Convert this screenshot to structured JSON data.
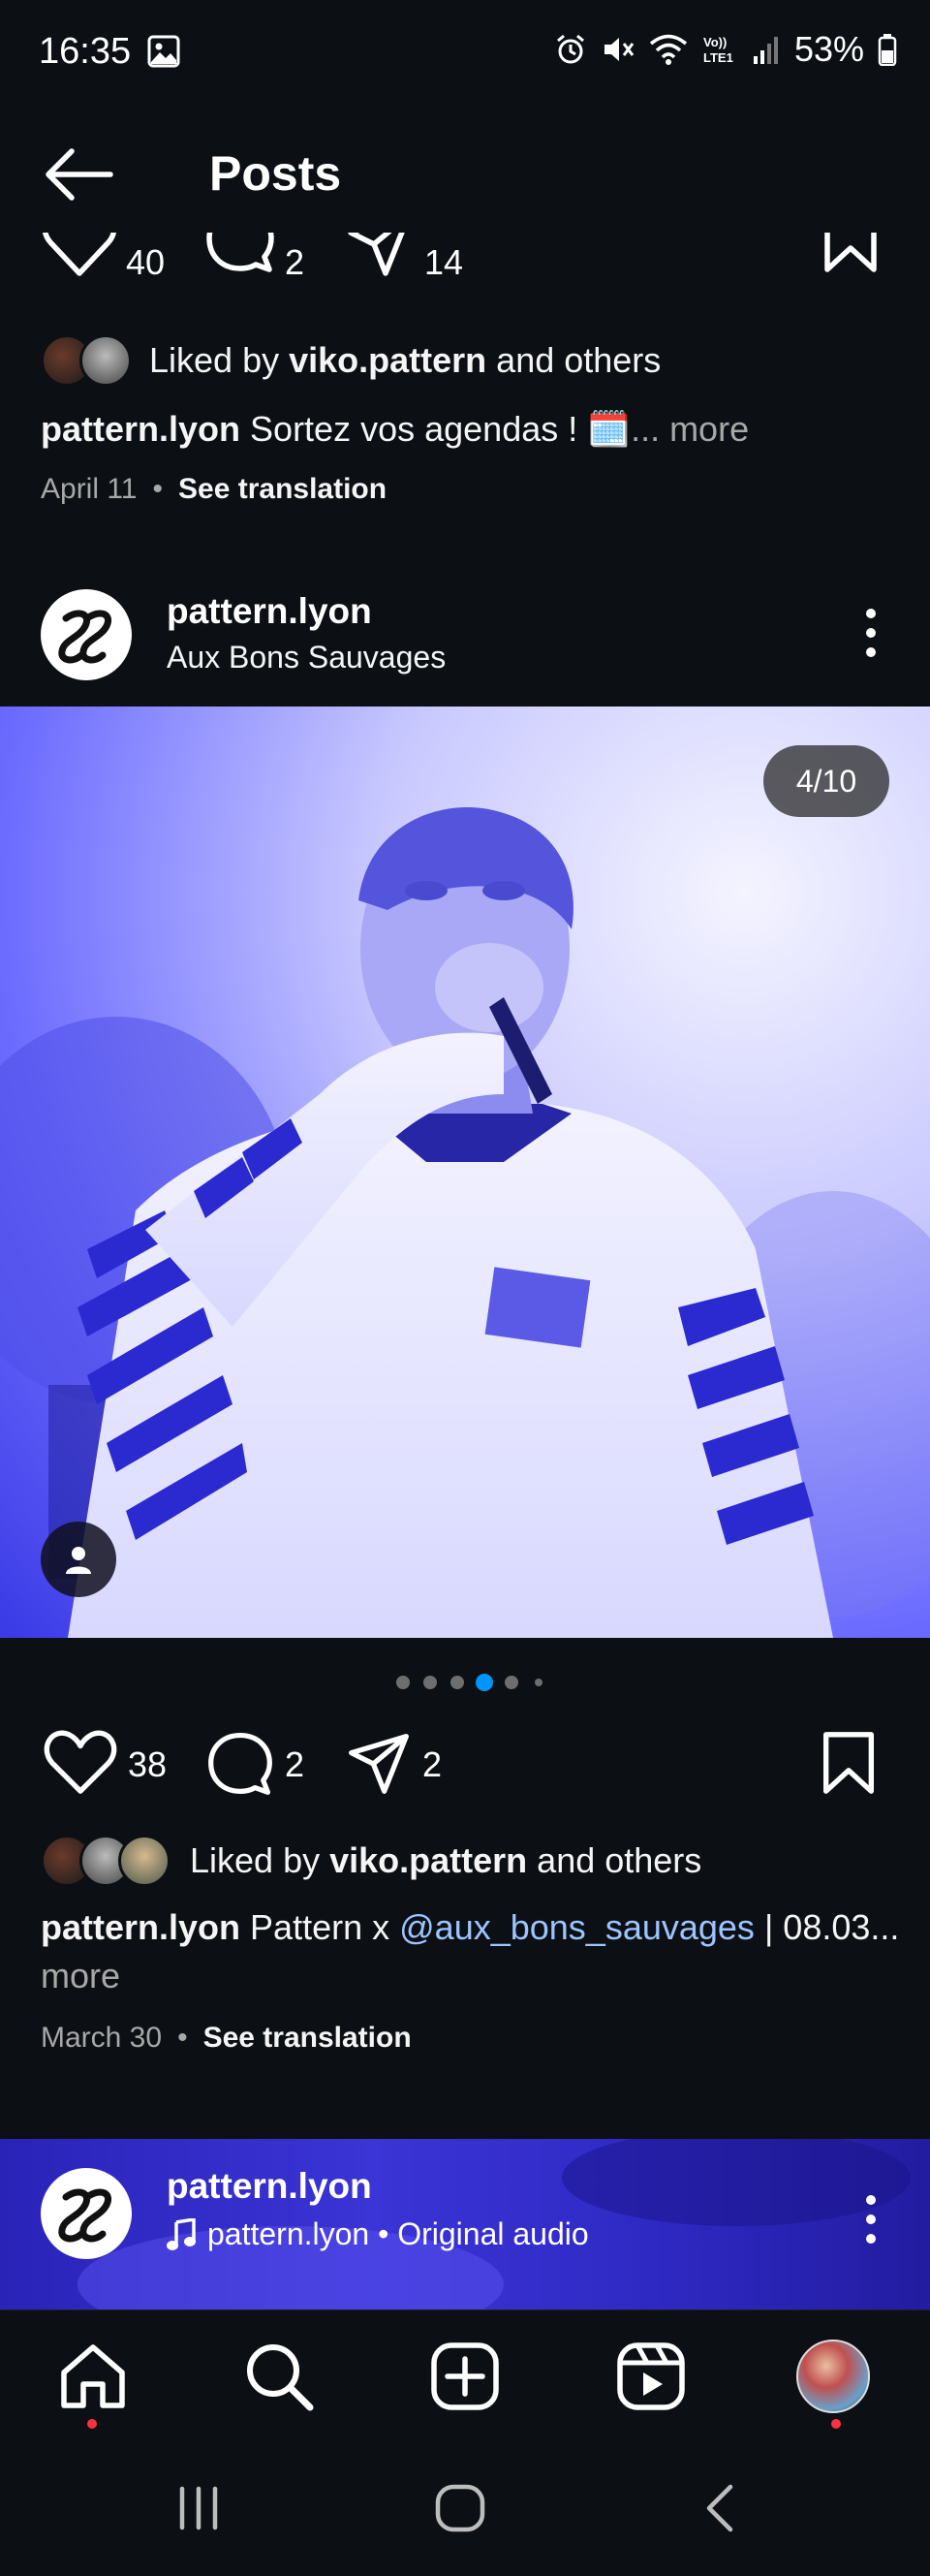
{
  "status_bar": {
    "time": "16:35",
    "battery": "53%",
    "icons": [
      "gallery-icon",
      "alarm-icon",
      "mute-icon",
      "wifi-icon",
      "volte-icon",
      "signal-icon",
      "battery-icon"
    ]
  },
  "header": {
    "title": "Posts",
    "back_icon": "arrow-left-icon"
  },
  "prev_post": {
    "likes": "40",
    "comments": "2",
    "shares": "14",
    "liked_by_prefix": "Liked by",
    "liked_by_user": "viko.pattern",
    "liked_by_suffix": "and others",
    "caption_user": "pattern.lyon",
    "caption_text": "Sortez vos agendas ! 🗓️",
    "caption_more": "... more",
    "date": "April 11",
    "see_translation": "See translation"
  },
  "post": {
    "username": "pattern.lyon",
    "location": "Aux Bons Sauvages",
    "image_counter": "4/10",
    "likes": "38",
    "comments": "2",
    "shares": "2",
    "liked_by_prefix": "Liked by",
    "liked_by_user": "viko.pattern",
    "liked_by_suffix": "and others",
    "caption_user": "pattern.lyon",
    "caption_text": "Pattern x",
    "caption_mention": "@aux_bons_sauvages",
    "caption_rest": "| 08.03...",
    "caption_more": "more",
    "date": "March 30",
    "see_translation": "See translation",
    "carousel_active_index": 3,
    "carousel_dots": 6
  },
  "next_post": {
    "username": "pattern.lyon",
    "audio": "pattern.lyon • Original audio"
  },
  "bottom_nav": {
    "items": [
      "home-icon",
      "search-icon",
      "create-icon",
      "reels-icon",
      "profile-avatar"
    ]
  },
  "colors": {
    "background": "#0c1014",
    "accent_blue": "#0095f6",
    "mention": "#9cc4ff",
    "notification_red": "#ff3040"
  }
}
